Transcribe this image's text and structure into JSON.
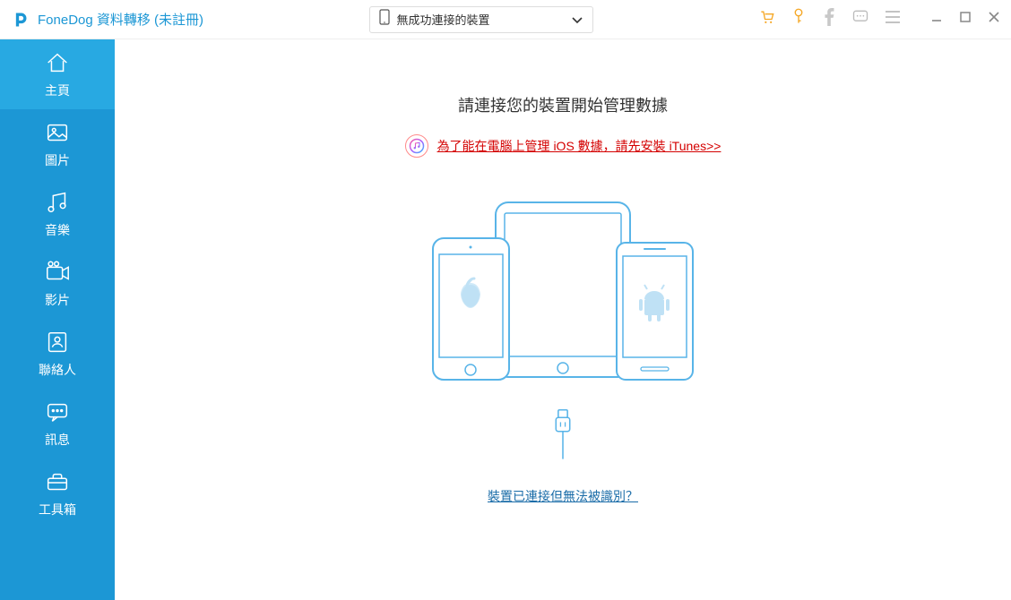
{
  "app": {
    "title": "FoneDog 資料轉移 (未註冊)"
  },
  "device_selector": {
    "text": "無成功連接的裝置"
  },
  "toolbar_icons": {
    "cart": "cart-icon",
    "key": "key-icon",
    "facebook": "facebook-icon",
    "feedback": "feedback-icon",
    "menu": "menu-icon"
  },
  "window_controls": {
    "min": "window-minimize",
    "max": "window-maximize",
    "close": "window-close"
  },
  "sidebar": {
    "items": [
      {
        "label": "主頁",
        "icon": "home-icon",
        "active": true
      },
      {
        "label": "圖片",
        "icon": "image-icon",
        "active": false
      },
      {
        "label": "音樂",
        "icon": "music-icon",
        "active": false
      },
      {
        "label": "影片",
        "icon": "video-icon",
        "active": false
      },
      {
        "label": "聯絡人",
        "icon": "contacts-icon",
        "active": false
      },
      {
        "label": "訊息",
        "icon": "messages-icon",
        "active": false
      },
      {
        "label": "工具箱",
        "icon": "toolbox-icon",
        "active": false
      }
    ]
  },
  "main": {
    "title": "請連接您的裝置開始管理數據",
    "itunes_prompt": "為了能在電腦上管理 iOS 數據，請先安裝 iTunes>>",
    "troubleshoot": "裝置已連接但無法被識別？"
  },
  "colors": {
    "primary": "#1C97D5",
    "primary_light": "#28A9E2",
    "danger": "#d40000",
    "orange": "#f5a623",
    "stroke_blue": "#58b4e8"
  }
}
